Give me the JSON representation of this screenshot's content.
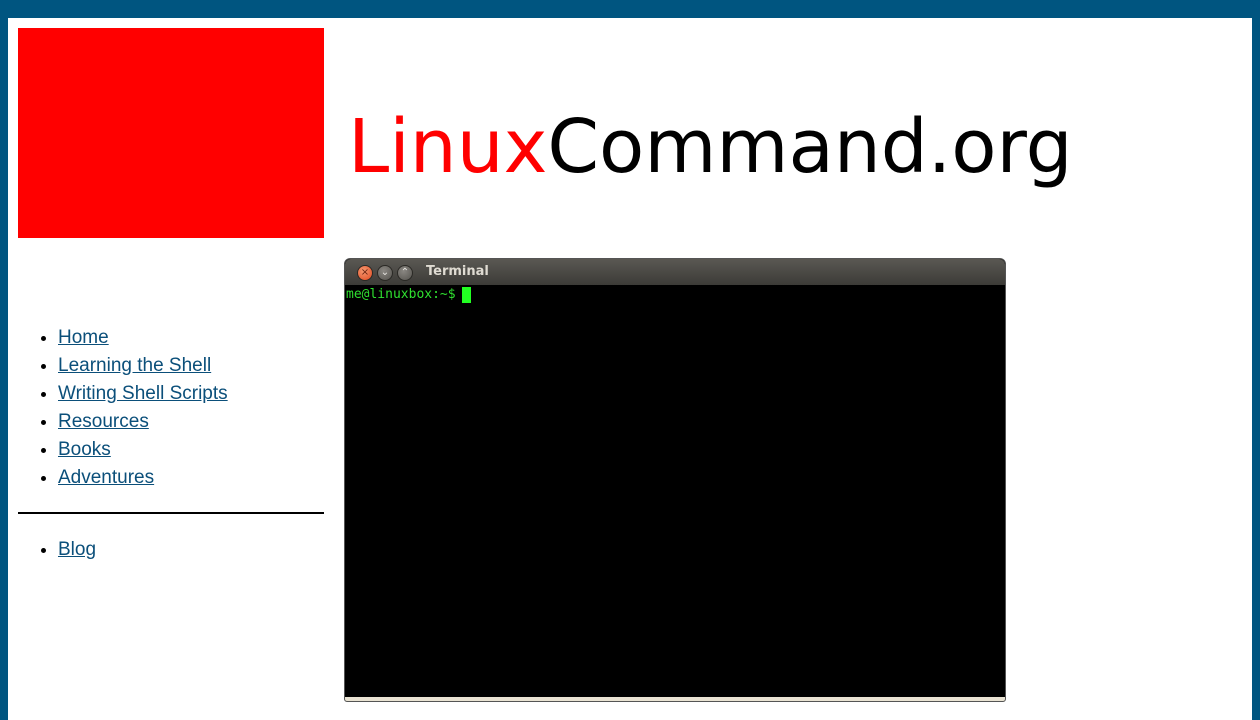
{
  "header": {
    "logo_part1": "Linux",
    "logo_part2": "Command.org",
    "accent_color": "#ff0000"
  },
  "nav": {
    "main_items": [
      {
        "label": "Home"
      },
      {
        "label": "Learning the Shell"
      },
      {
        "label": "Writing Shell Scripts"
      },
      {
        "label": "Resources"
      },
      {
        "label": "Books"
      },
      {
        "label": "Adventures"
      }
    ],
    "secondary_items": [
      {
        "label": "Blog"
      }
    ]
  },
  "terminal": {
    "title": "Terminal",
    "prompt": "me@linuxbox:~$",
    "buttons": {
      "close_icon": "×",
      "minimize_icon": "⌄",
      "maximize_icon": "⌃"
    }
  },
  "colors": {
    "background": "#005580",
    "link": "#0b4f7a",
    "prompt": "#2fe02f"
  }
}
